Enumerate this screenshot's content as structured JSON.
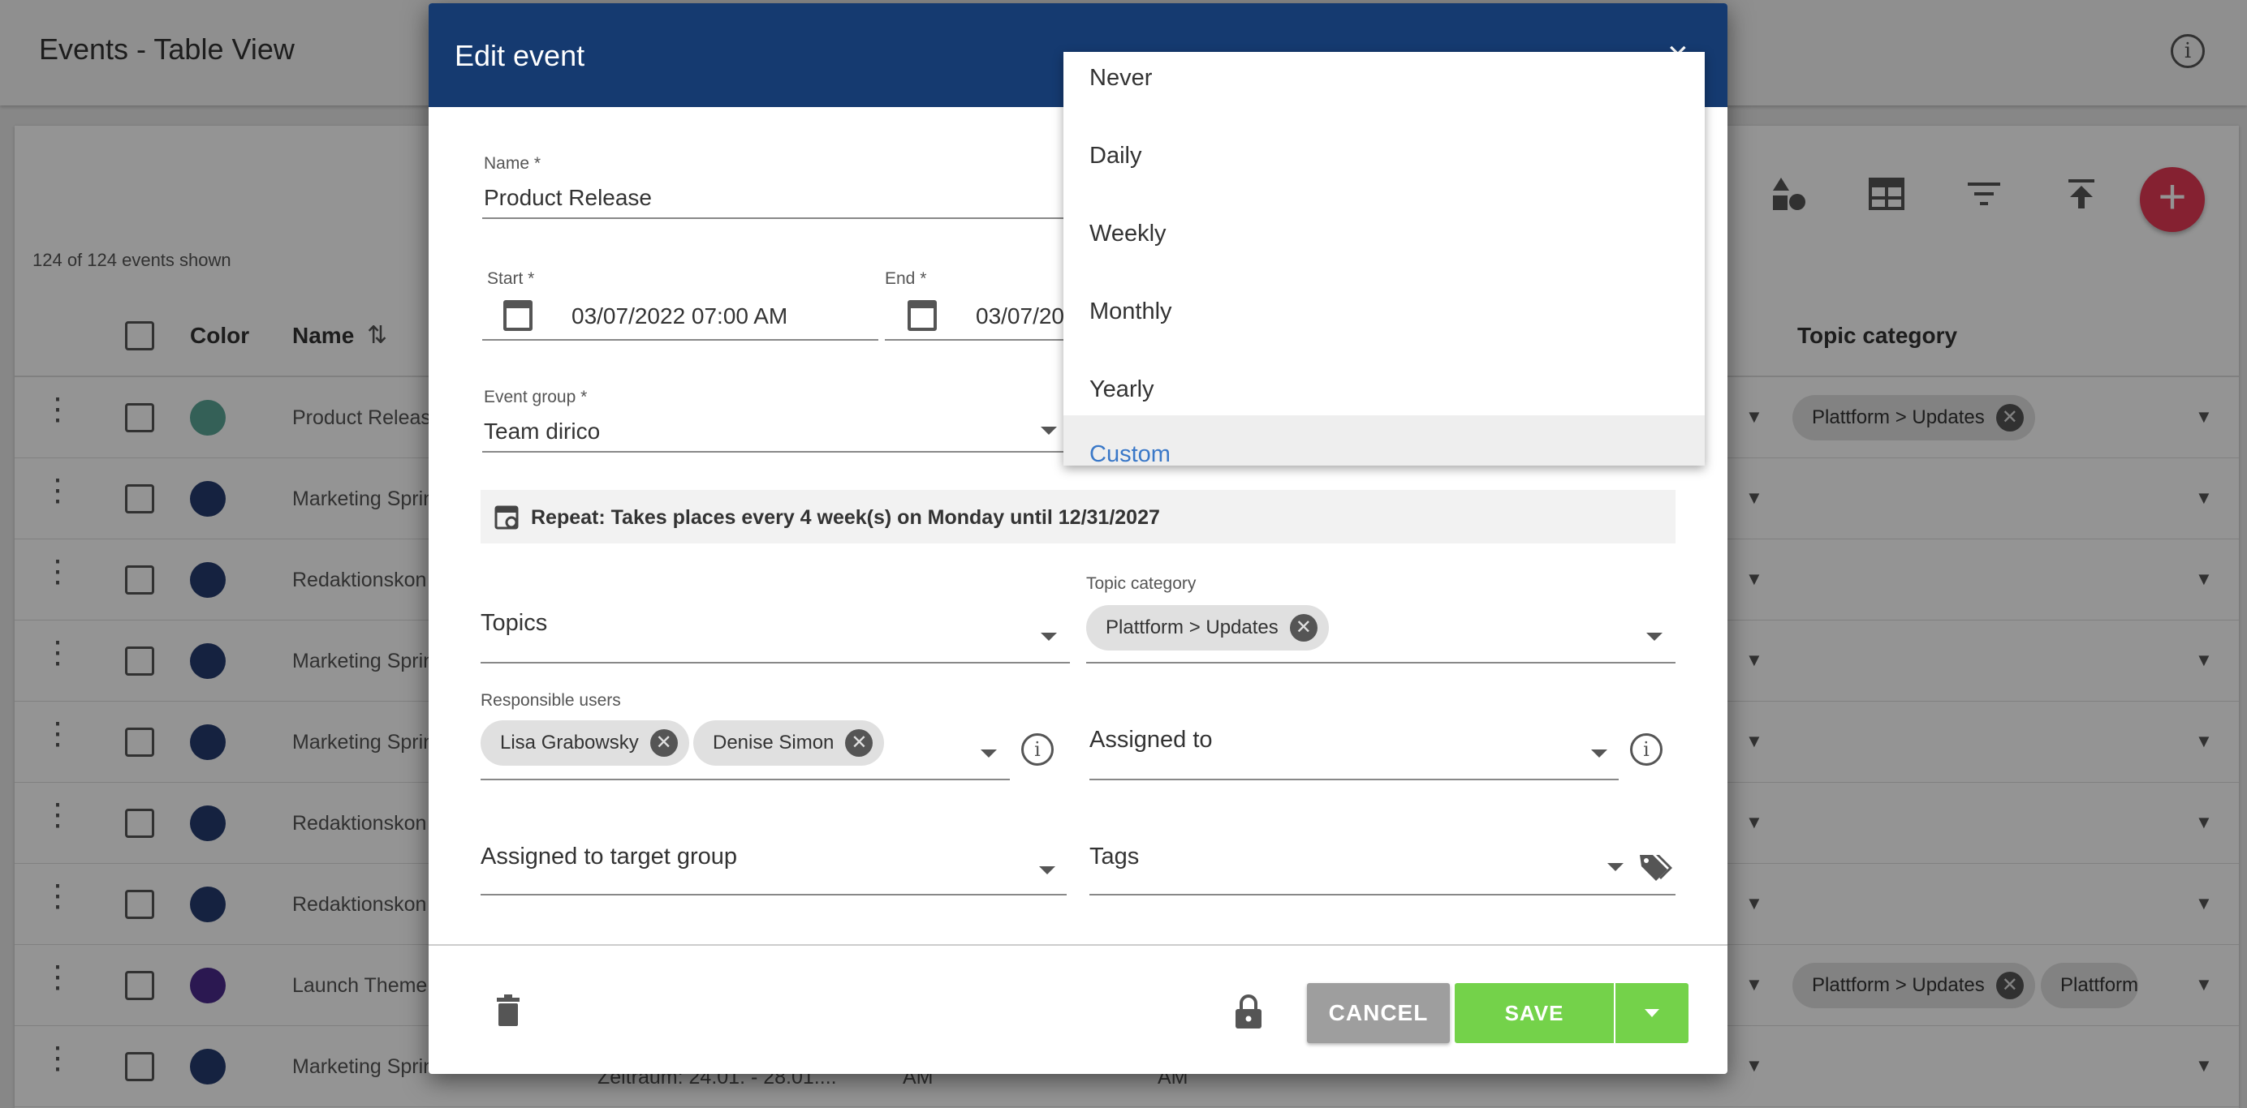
{
  "page": {
    "title": "Events - Table View",
    "shown_count": "124 of 124 events shown"
  },
  "table": {
    "headers": {
      "color": "Color",
      "name": "Name",
      "topic_category": "Topic category"
    },
    "rows": [
      {
        "name": "Product Releas",
        "color": "#5aa597",
        "topic_chips": [
          "Plattform > Updates"
        ]
      },
      {
        "name": "Marketing Sprin",
        "color": "#253b6e",
        "topic_chips": []
      },
      {
        "name": "Redaktionskon",
        "color": "#253b6e",
        "topic_chips": []
      },
      {
        "name": "Marketing Sprin",
        "color": "#253b6e",
        "topic_chips": []
      },
      {
        "name": "Marketing Sprin",
        "color": "#253b6e",
        "topic_chips": []
      },
      {
        "name": "Redaktionskon",
        "color": "#253b6e",
        "topic_chips": []
      },
      {
        "name": "Redaktionskon",
        "color": "#253b6e",
        "topic_chips": []
      },
      {
        "name": "Launch Theme",
        "color": "#4b2a8c",
        "topic_chips": [
          "Plattform > Updates",
          "Plattform"
        ]
      },
      {
        "name": "Marketing Sprin",
        "color": "#253b6e",
        "topic_chips": []
      }
    ],
    "partial_row_text": [
      "Zeitraum: 24.01. - 28.01....",
      "AM",
      "AM"
    ]
  },
  "dialog": {
    "title": "Edit event",
    "close_glyph": "×",
    "name": {
      "label": "Name *",
      "value": "Product Release"
    },
    "start": {
      "label": "Start *",
      "value": "03/07/2022 07:00 AM"
    },
    "end": {
      "label": "End *",
      "value": "03/07/20"
    },
    "event_group": {
      "label": "Event group *",
      "value": "Team dirico"
    },
    "repeat_text": "Repeat: Takes places every 4 week(s) on Monday until 12/31/2027",
    "topics": {
      "placeholder": "Topics"
    },
    "topic_category": {
      "label": "Topic category",
      "chip": "Plattform > Updates"
    },
    "responsible_users": {
      "label": "Responsible users",
      "chips": [
        "Lisa Grabowsky",
        "Denise Simon"
      ]
    },
    "assigned_to": {
      "placeholder": "Assigned to"
    },
    "assigned_target_group": {
      "placeholder": "Assigned to target group"
    },
    "tags": {
      "placeholder": "Tags"
    },
    "cancel_label": "CANCEL",
    "save_label": "SAVE"
  },
  "repeat_menu": {
    "options": [
      "Never",
      "Daily",
      "Weekly",
      "Monthly",
      "Yearly",
      "Custom"
    ],
    "selected": "Custom"
  },
  "colors": {
    "header": "#153a70",
    "save": "#74d24a",
    "fab": "#e53955",
    "selected_option": "#3a78c8"
  }
}
